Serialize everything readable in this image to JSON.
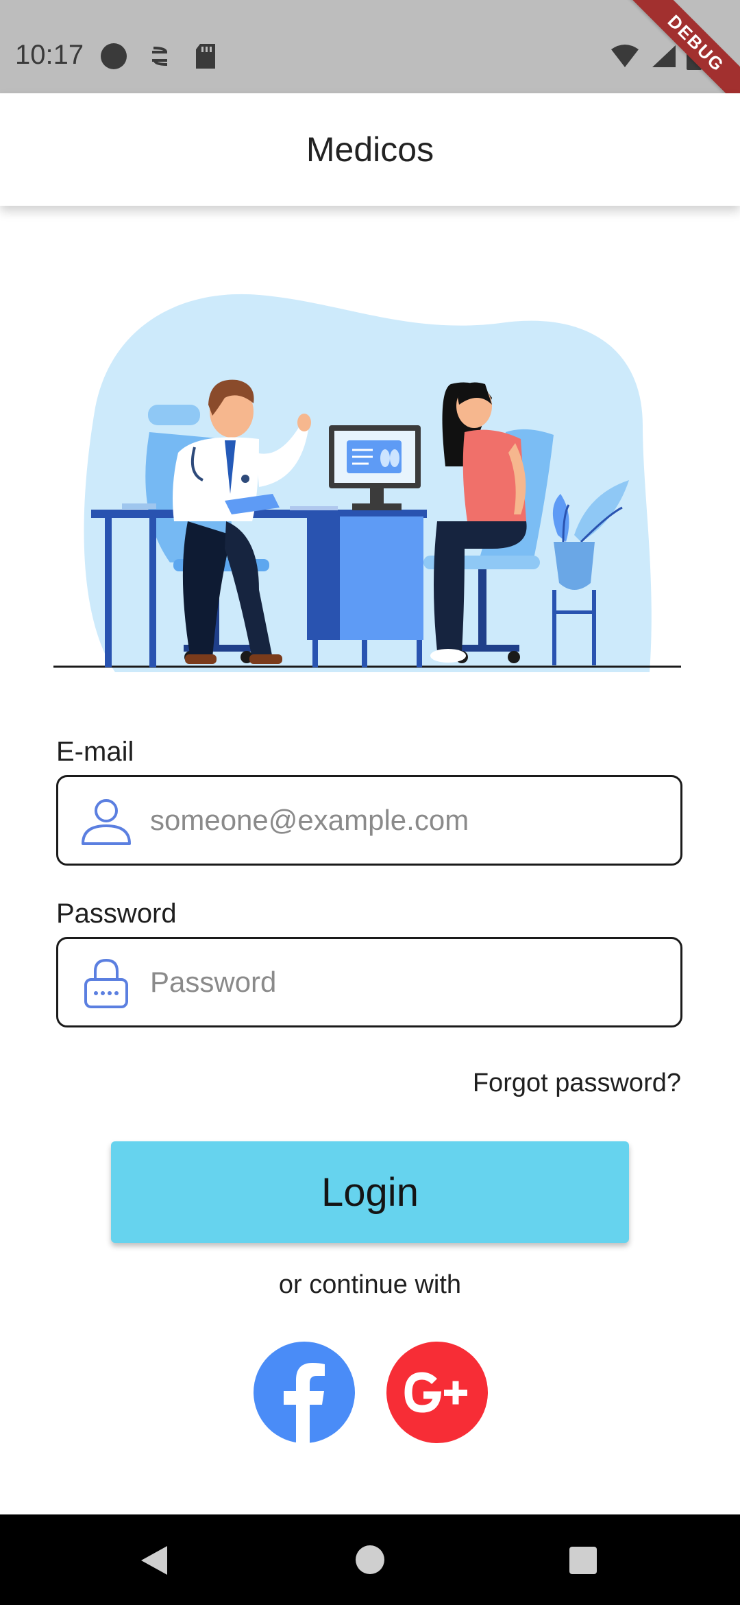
{
  "status_bar": {
    "time": "10:17",
    "left_icons": [
      "circle-icon",
      "sync-icon",
      "sd-card-icon"
    ],
    "right_icons": [
      "wifi-icon",
      "signal-icon",
      "battery-icon"
    ],
    "debug_label": "DEBUG"
  },
  "app_bar": {
    "title": "Medicos"
  },
  "hero": {
    "icon": "doctor-consultation-illustration"
  },
  "form": {
    "email_label": "E-mail",
    "email_placeholder": "someone@example.com",
    "email_value": "",
    "email_icon": "user-icon",
    "password_label": "Password",
    "password_placeholder": "Password",
    "password_value": "",
    "password_icon": "lock-icon",
    "forgot_label": "Forgot password?",
    "login_label": "Login"
  },
  "social": {
    "continue_label": "or continue with",
    "buttons": [
      {
        "name": "facebook",
        "color": "#4a8cf7"
      },
      {
        "name": "google-plus",
        "color": "#f72d36"
      }
    ]
  },
  "colors": {
    "accent": "#66d3ee",
    "icon_blue": "#5b7fe0"
  }
}
